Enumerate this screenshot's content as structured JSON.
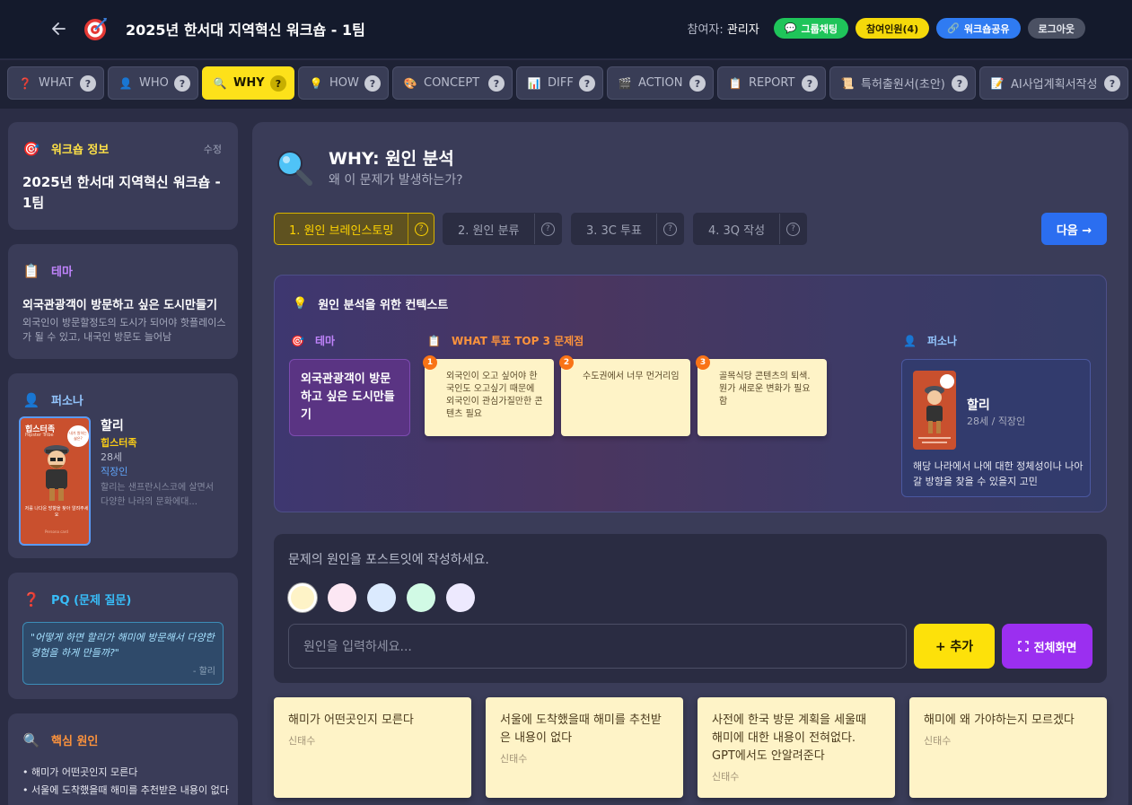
{
  "header": {
    "title": "2025년 한서대 지역혁신 워크숍 - 1팀",
    "participant_label": "참여자:",
    "participant_name": "관리자",
    "buttons": {
      "chat": "그룹채팅",
      "members": "참여인원(4)",
      "share": "워크숍공유",
      "logout": "로그아웃"
    }
  },
  "tabs": [
    {
      "label": "WHAT",
      "icon": "❓"
    },
    {
      "label": "WHO",
      "icon": "👤"
    },
    {
      "label": "WHY",
      "icon": "🔍"
    },
    {
      "label": "HOW",
      "icon": "💡"
    },
    {
      "label": "CONCEPT",
      "icon": "🎨"
    },
    {
      "label": "DIFF",
      "icon": "📊"
    },
    {
      "label": "ACTION",
      "icon": "🎬"
    },
    {
      "label": "REPORT",
      "icon": "📋"
    },
    {
      "label": "특허출원서(초안)",
      "icon": "📜"
    },
    {
      "label": "AI사업계획서작성",
      "icon": "📝"
    }
  ],
  "active_tab": "WHY",
  "sidebar": {
    "workshop": {
      "heading": "워크숍 정보",
      "edit": "수정",
      "name": "2025년 한서대 지역혁신 워크숍 - 1팀"
    },
    "theme": {
      "heading": "테마",
      "title": "외국관광객이 방문하고 싶은 도시만들기",
      "desc": "외국인이 방문할정도의 도시가 되어야 핫플레이스가 될 수 있고, 내국인 방문도 늘어남"
    },
    "persona": {
      "heading": "퍼소나",
      "name": "할리",
      "type": "힙스터족",
      "age": "28세",
      "job": "직장인",
      "desc": "할리는 샌프란시스코에 살면서 다양한 나라의 문화에대...",
      "card_title": "힙스터족",
      "card_subtitle": "Hipster Tribe",
      "card_bubble": "내가 원하는 삶은?",
      "card_caption": "저를 나다운 방향을 찾아 알려주세요",
      "card_footer": "Persona card"
    },
    "pq": {
      "heading": "PQ (문제 질문)",
      "question": "\"어떻게 하면 할리가 해미에 방문해서 다양한 경험을 하게 만들까?\"",
      "author": "- 할리"
    },
    "causes": {
      "heading": "핵심 원인",
      "items": [
        "해미가 어떤곳인지 모른다",
        "서울에 도착했을때 해미를 추천받은 내용이 없다"
      ]
    }
  },
  "main": {
    "title": "WHY: 원인 분석",
    "subtitle": "왜 이 문제가 발생하는가?",
    "steps": [
      "1. 원인 브레인스토밍",
      "2. 원인 분류",
      "3. 3C 투표",
      "4. 3Q 작성"
    ],
    "next": "다음 →",
    "context": {
      "title": "원인 분석을 위한 컨텍스트",
      "theme_label": "테마",
      "theme_text": "외국관광객이 방문하고 싶은 도시만들기",
      "top3_label": "WHAT 투표 TOP 3 문제점",
      "top3": [
        {
          "num": "1",
          "text": "외국인이 오고 싶어야 한국인도 오고싶기 때문에 외국인이 관심가질만한 콘텐츠 필요"
        },
        {
          "num": "2",
          "text": "수도권에서 너무 먼거리임"
        },
        {
          "num": "3",
          "text": "골목식당 콘텐츠의 퇴색. 뭔가 새로운 변화가 필요함"
        }
      ],
      "persona_label": "퍼소나",
      "persona_name": "할리",
      "persona_meta": "28세 / 직장인",
      "persona_desc": "해당 나라에서 나에 대한 정체성이나 나아갈 방향을 찾을 수 있을지 고민"
    },
    "input": {
      "prompt": "문제의 원인을 포스트잇에 작성하세요.",
      "placeholder": "원인을 입력하세요...",
      "add": "+ 추가",
      "fullscreen": "전체화면",
      "swatches": [
        "#fef3c7",
        "#fce7f3",
        "#dbeafe",
        "#d1fae5",
        "#ede9fe"
      ]
    },
    "postits": [
      {
        "text": "해미가 어떤곳인지 모른다",
        "author": "신태수"
      },
      {
        "text": "서울에 도착했을때 해미를 추천받은 내용이 없다",
        "author": "신태수"
      },
      {
        "text": "사전에 한국 방문 계획을 세울때 해미에 대한 내용이 전혀없다. GPT에서도 안알려준다",
        "author": "신태수"
      },
      {
        "text": "해미에 왜 가야하는지 모르겠다",
        "author": "신태수"
      }
    ]
  },
  "colors": {
    "accent_yellow": "#fde11a",
    "accent_blue": "#2b6ef0",
    "accent_purple": "#9b2ff0",
    "header_bg": "#141a2c"
  }
}
